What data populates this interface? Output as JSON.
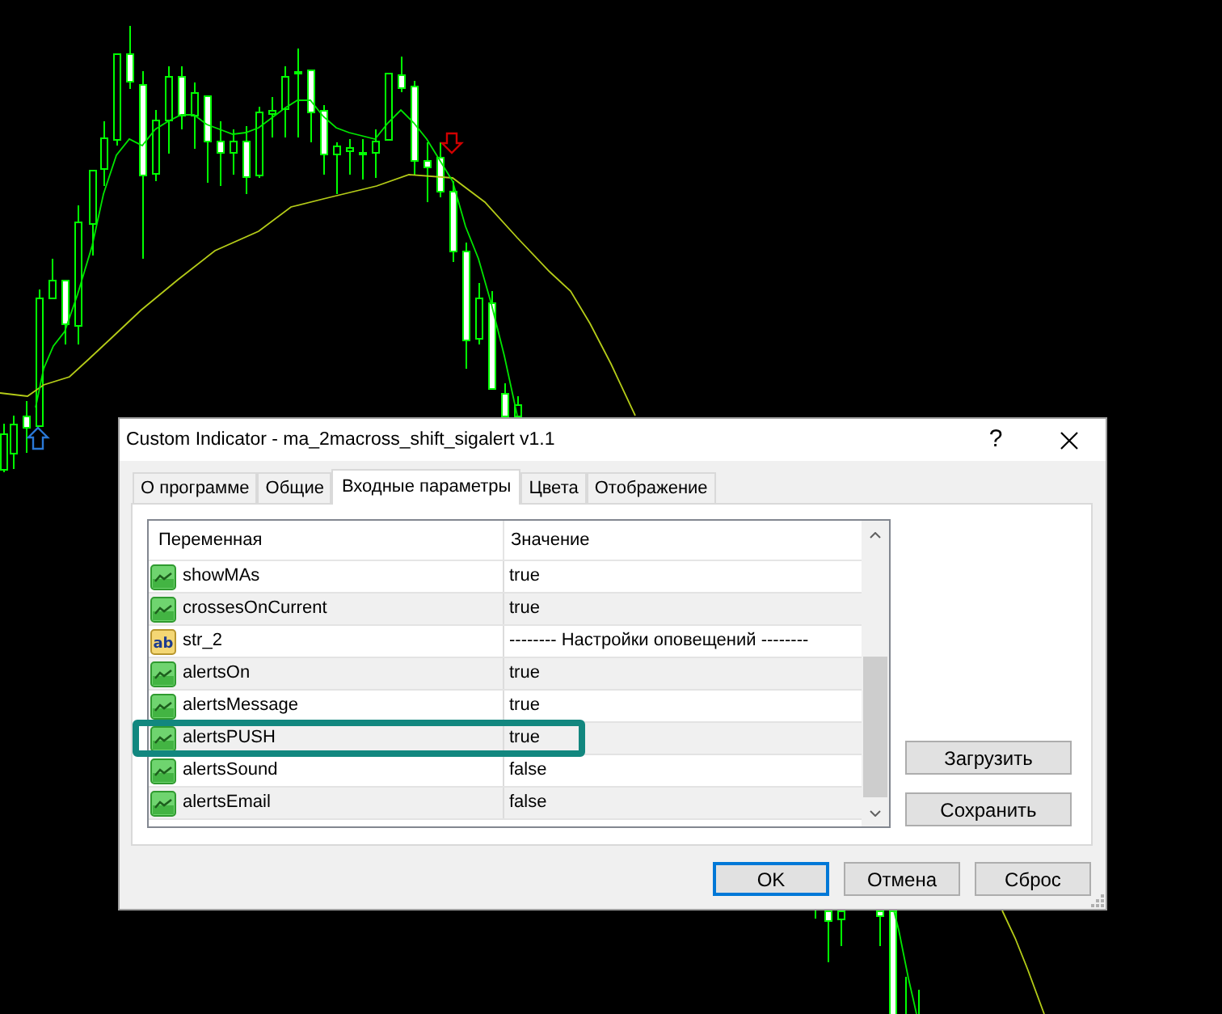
{
  "window": {
    "title": "Custom Indicator - ma_2macross_shift_sigalert v1.1",
    "help_button": "?"
  },
  "tabs": [
    {
      "label": "О программе",
      "selected": false
    },
    {
      "label": "Общие",
      "selected": false
    },
    {
      "label": "Входные параметры",
      "selected": true
    },
    {
      "label": "Цвета",
      "selected": false
    },
    {
      "label": "Отображение",
      "selected": false
    }
  ],
  "parameters": {
    "columns": [
      "Переменная",
      "Значение"
    ],
    "rows": [
      {
        "kind": "bool",
        "name": "showMAs",
        "value": "true",
        "highlighted": false
      },
      {
        "kind": "bool",
        "name": "crossesOnCurrent",
        "value": "true",
        "highlighted": false
      },
      {
        "kind": "string",
        "icon_text": "ab",
        "name": "str_2",
        "value": "-------- Настройки оповещений --------",
        "highlighted": false
      },
      {
        "kind": "bool",
        "name": "alertsOn",
        "value": "true",
        "highlighted": false
      },
      {
        "kind": "bool",
        "name": "alertsMessage",
        "value": "true",
        "highlighted": false
      },
      {
        "kind": "bool",
        "name": "alertsPUSH",
        "value": "true",
        "highlighted": true
      },
      {
        "kind": "bool",
        "name": "alertsSound",
        "value": "false",
        "highlighted": false
      },
      {
        "kind": "bool",
        "name": "alertsEmail",
        "value": "false",
        "highlighted": false
      }
    ]
  },
  "side_buttons": [
    "Загрузить",
    "Сохранить"
  ],
  "footer_buttons": [
    {
      "label": "OK",
      "focused": true
    },
    {
      "label": "Отмена",
      "focused": false
    },
    {
      "label": "Сброс",
      "focused": false
    }
  ]
}
